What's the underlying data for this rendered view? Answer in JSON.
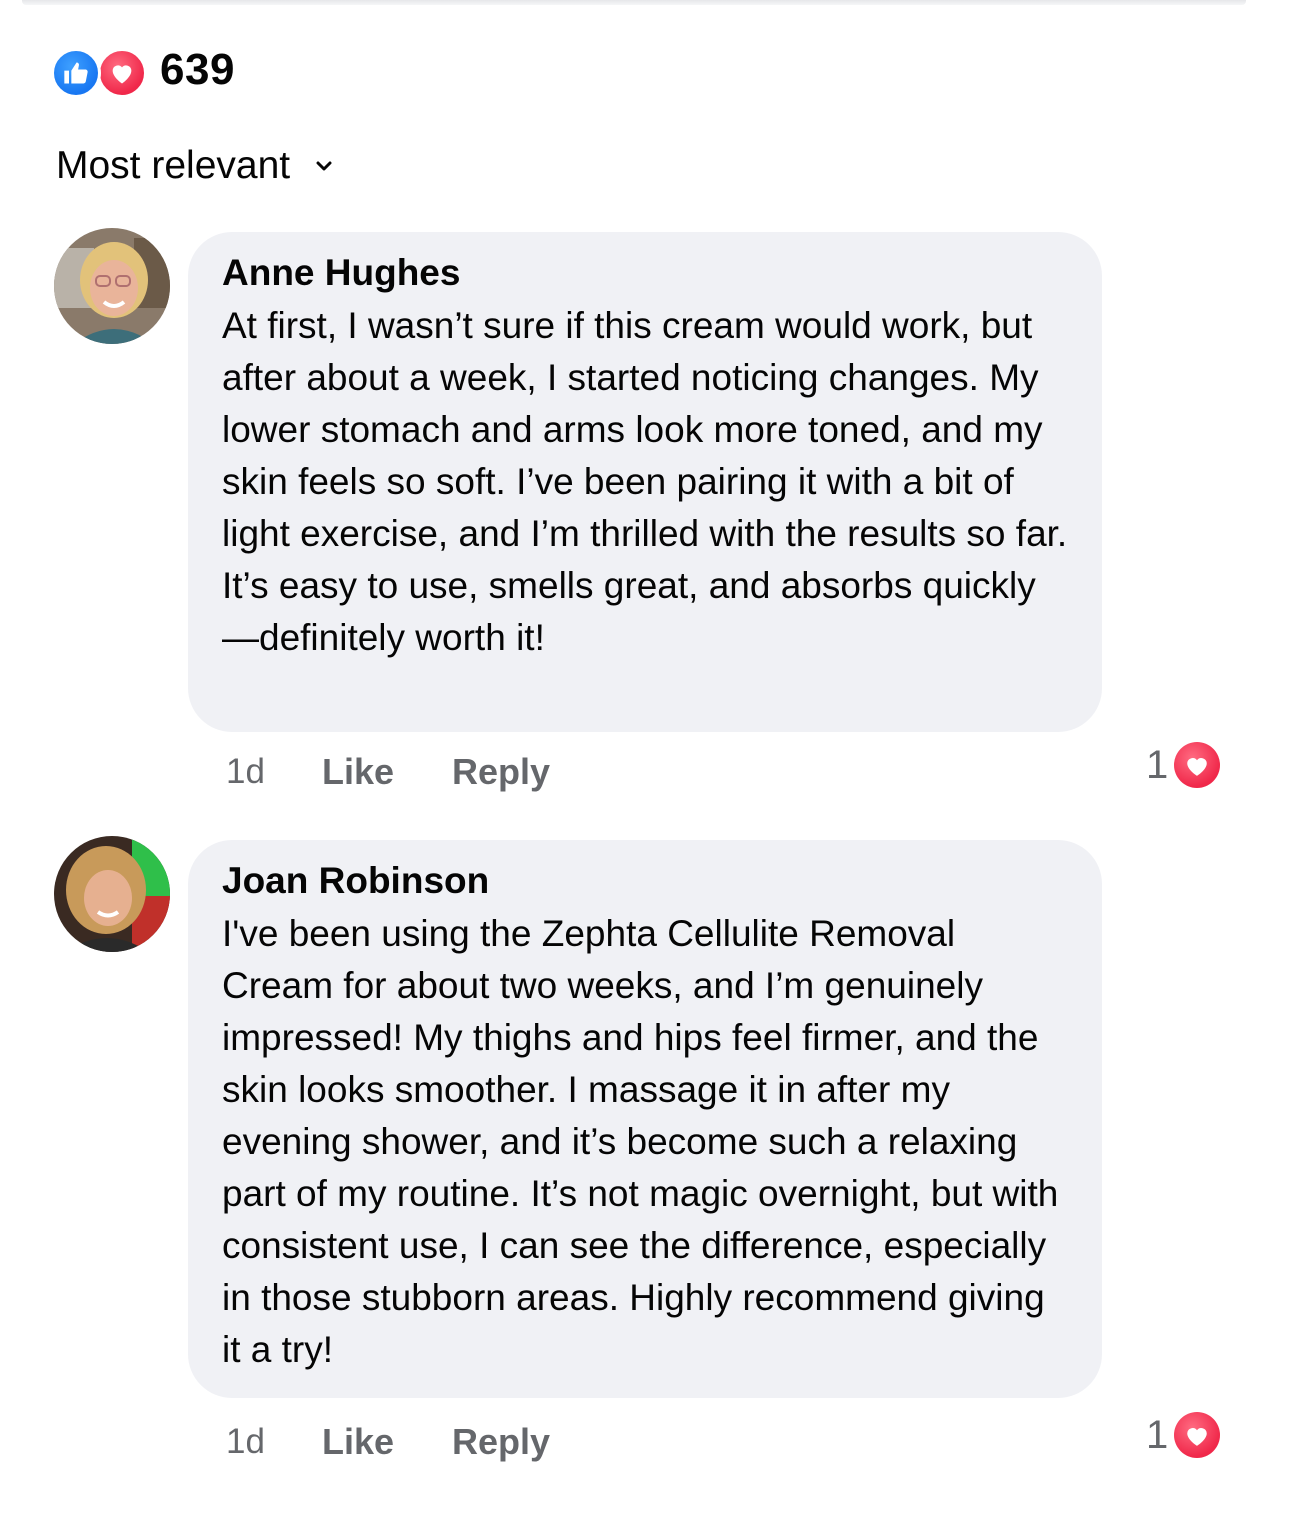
{
  "reactions": {
    "count": "639",
    "icons": [
      "like-icon",
      "love-icon"
    ],
    "like_color": "#1877f2",
    "love_color": "#f0284a"
  },
  "sort": {
    "label": "Most relevant",
    "icon": "chevron-down-icon"
  },
  "comments": [
    {
      "author": "Anne Hughes",
      "text": "At first, I wasn’t sure if this cream would work, but after about a week, I started noticing changes. My lower stomach and arms look more toned, and my skin feels so soft. I’ve been pairing it with a bit of light exercise, and I’m thrilled with the results so far. It’s easy to use, smells great, and absorbs quickly—definitely worth it!",
      "time": "1d",
      "like_label": "Like",
      "reply_label": "Reply",
      "reaction_count": "1",
      "reaction_icon": "love-icon"
    },
    {
      "author": "Joan Robinson",
      "text": "I've been using the Zephta Cellulite Removal Cream for about two weeks, and I’m genuinely impressed! My thighs and hips feel firmer, and the skin looks smoother. I massage it in after my evening shower, and it’s become such a relaxing part of my routine. It’s not magic overnight, but with consistent use, I can see the difference, especially in those stubborn areas. Highly recommend giving it a try!",
      "time": "1d",
      "like_label": "Like",
      "reply_label": "Reply",
      "reaction_count": "1",
      "reaction_icon": "love-icon"
    }
  ],
  "colors": {
    "bubble": "#f0f1f5",
    "secondary_text": "#65676b",
    "primary_text": "#050505"
  }
}
